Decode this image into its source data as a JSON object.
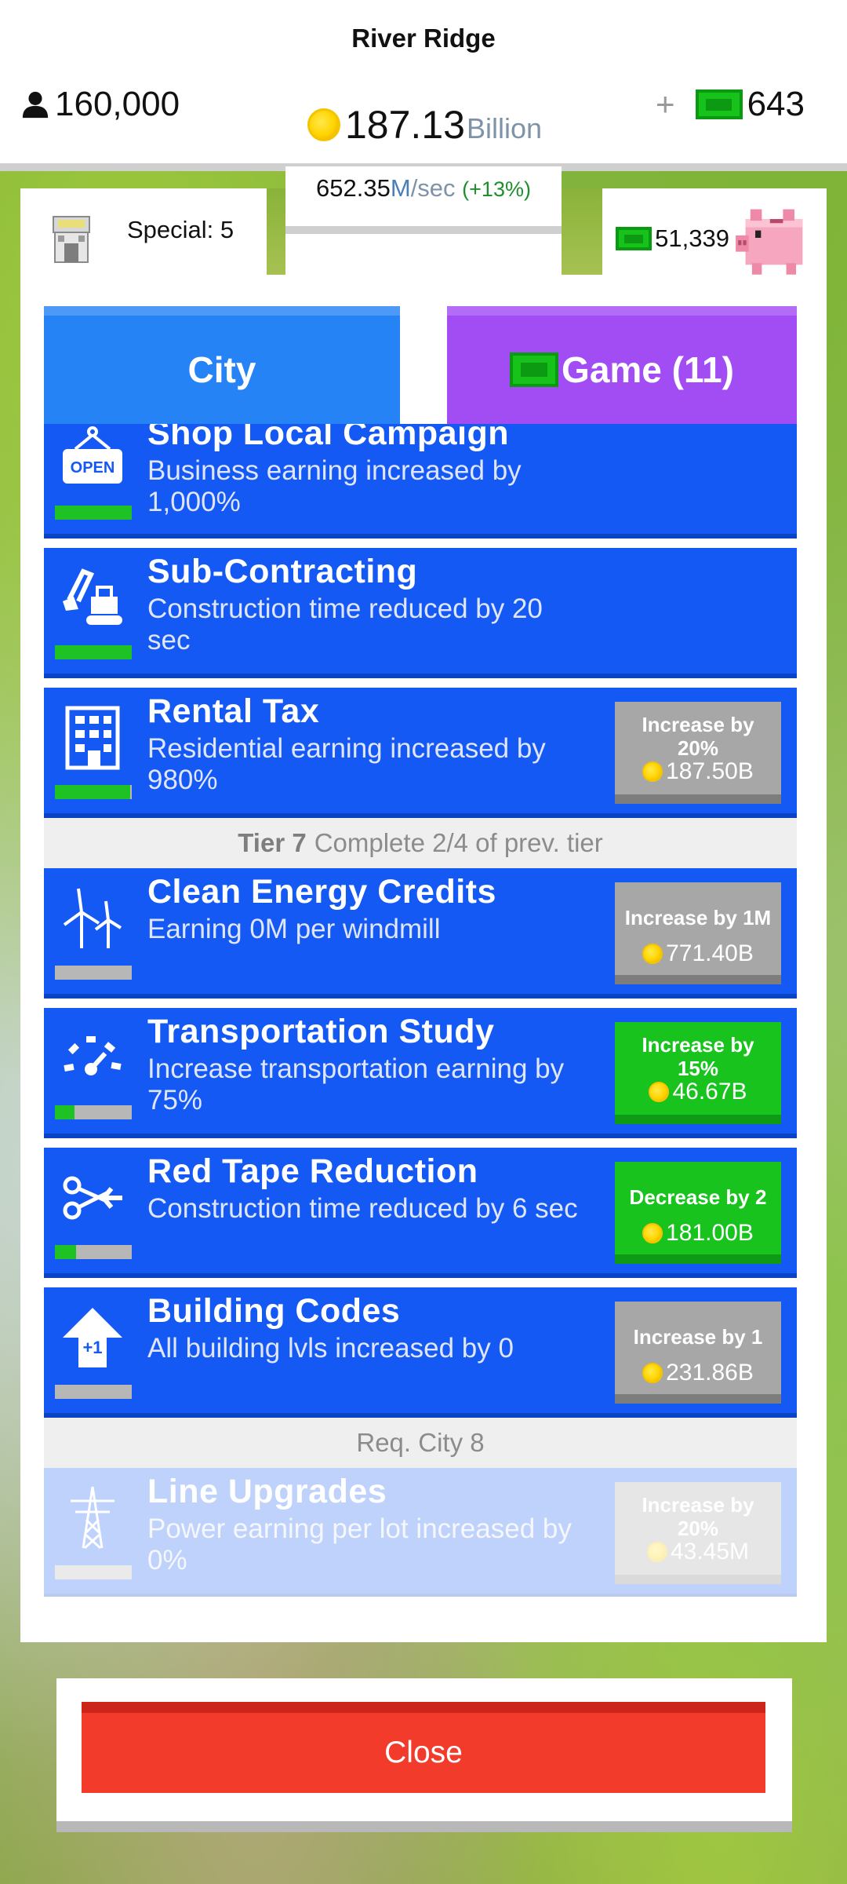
{
  "header": {
    "town_name": "River Ridge",
    "population": "160,000",
    "gold_amount": "187.13",
    "gold_unit": "Billion",
    "cash_plus": "+",
    "cash_amount": "643",
    "rate_value": "652.35",
    "rate_m": "M",
    "rate_per_sec": "/sec",
    "rate_pct": "(+13%)"
  },
  "panel": {
    "special_label": "Special: 5",
    "cash_balance": "51,339",
    "tabs": {
      "city": "City",
      "game": "Game (11)"
    }
  },
  "upgrades": [
    {
      "title": "Shop Local Campaign",
      "desc": "Business earning increased by 1,000%",
      "icon": "open-sign-icon",
      "progress": 1.0
    },
    {
      "title": "Sub-Contracting",
      "desc": "Construction time reduced by 20 sec",
      "icon": "excavator-icon",
      "progress": 1.0
    },
    {
      "title": "Rental Tax",
      "desc": "Residential earning increased by 980%",
      "icon": "apartment-building-icon",
      "progress": 0.98,
      "btn_line1": "Increase by",
      "btn_line2": "20%",
      "btn_price": "187.50B",
      "btn_state": "disabled"
    }
  ],
  "tier7": {
    "tier_label": "Tier 7",
    "requirement": "Complete 2/4 of prev. tier"
  },
  "tier7_upgrades": [
    {
      "title": "Clean Energy Credits",
      "desc": "Earning 0M per windmill",
      "icon": "windmill-icon",
      "progress": 0.0,
      "btn_line1": "Increase by 1M",
      "btn_price": "771.40B",
      "btn_state": "disabled"
    },
    {
      "title": "Transportation Study",
      "desc": "Increase transportation earning by 75%",
      "icon": "speedometer-icon",
      "progress": 0.25,
      "btn_line1": "Increase by",
      "btn_line2": "15%",
      "btn_price": "46.67B",
      "btn_state": "available"
    },
    {
      "title": "Red Tape Reduction",
      "desc": "Construction time reduced by 6 sec",
      "icon": "scissors-icon",
      "progress": 0.28,
      "btn_line1": "Decrease by 2",
      "btn_price": "181.00B",
      "btn_state": "available"
    },
    {
      "title": "Building Codes",
      "desc": "All building lvls increased by 0",
      "icon": "arrow-plus-one-icon",
      "progress": 0.0,
      "btn_line1": "Increase by 1",
      "btn_price": "231.86B",
      "btn_state": "disabled"
    }
  ],
  "tier8": {
    "requirement": "Req. City 8"
  },
  "locked_upgrade": {
    "title": "Line Upgrades",
    "desc": "Power earning per lot increased by 0%",
    "icon": "power-tower-icon",
    "progress": 0.0,
    "btn_line1": "Increase by",
    "btn_line2": "20%",
    "btn_price": "43.45M"
  },
  "close_label": "Close",
  "colors": {
    "blue_tab": "#2683f6",
    "purple_tab": "#a24cf3",
    "item_blue": "#1559f4",
    "green_btn": "#18c31e",
    "grey_btn": "#a7a7a7",
    "close_red": "#f23b2b"
  }
}
